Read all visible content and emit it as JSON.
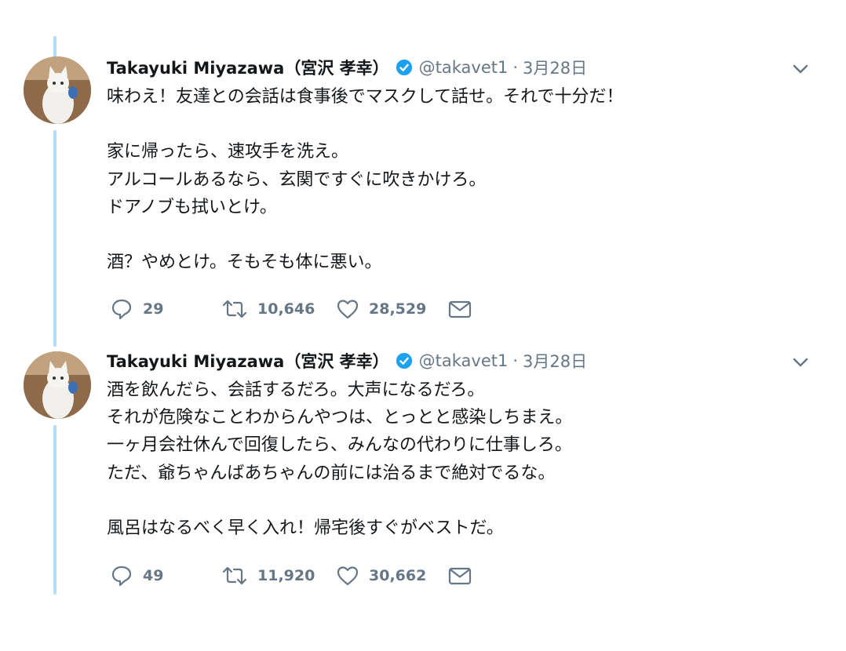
{
  "tweets": [
    {
      "author_name": "Takayuki Miyazawa（宮沢 孝幸）",
      "handle": "@takavet1",
      "separator": "·",
      "date": "3月28日",
      "text": "味わえ！友達との会話は食事後でマスクして話せ。それで十分だ！\n\n家に帰ったら、速攻手を洗え。\nアルコールあるなら、玄関ですぐに吹きかけろ。\nドアノブも拭いとけ。\n\n酒？やめとけ。そもそも体に悪い。",
      "replies": "29",
      "retweets": "10,646",
      "likes": "28,529"
    },
    {
      "author_name": "Takayuki Miyazawa（宮沢 孝幸）",
      "handle": "@takavet1",
      "separator": "·",
      "date": "3月28日",
      "text": "酒を飲んだら、会話するだろ。大声になるだろ。\nそれが危険なことわからんやつは、とっとと感染しちまえ。\n一ヶ月会社休んで回復したら、みんなの代わりに仕事しろ。\nただ、爺ちゃんばあちゃんの前には治るまで絶対でるな。\n\n風呂はなるべく早く入れ！帰宅後すぐがベストだ。",
      "replies": "49",
      "retweets": "11,920",
      "likes": "30,662"
    }
  ],
  "colors": {
    "thread_line": "#b3dcf6",
    "verified_badge": "#1da1f2",
    "secondary_text": "#657786",
    "primary_text": "#14171a"
  },
  "icons": [
    "reply-icon",
    "retweet-icon",
    "like-icon",
    "dm-icon",
    "verified-icon",
    "chevron-down-icon"
  ]
}
